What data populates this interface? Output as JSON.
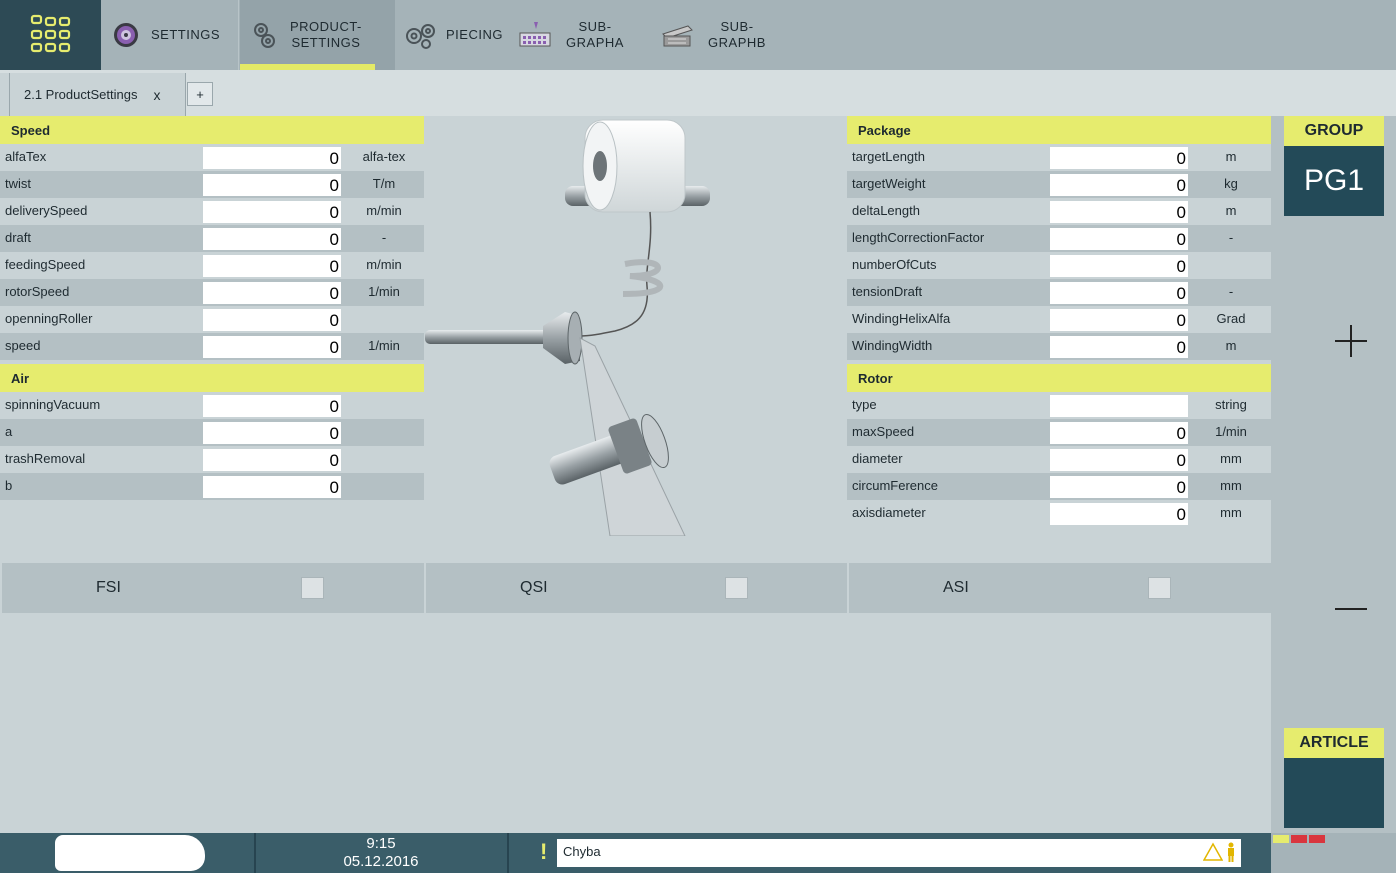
{
  "nav": {
    "settings": "SETTINGS",
    "product_line1": "PRODUCT-",
    "product_line2": "SETTINGS",
    "piecing": "PIECING",
    "suba_line1": "SUB-",
    "suba_line2": "GRAPHA",
    "subb_line1": "SUB-",
    "subb_line2": "GRAPHB",
    "icons": [
      "app-grid-icon",
      "settings-disc-icon",
      "gears-icon",
      "gears-icon",
      "keyboard-icon",
      "device-icon"
    ],
    "accent": "#e6ec6e"
  },
  "tabs": {
    "active_label": "2.1 ProductSettings",
    "close": "x",
    "add": "+"
  },
  "speed": {
    "title": "Speed",
    "rows": [
      {
        "label": "alfaTex",
        "value": "0",
        "unit": "alfa-tex"
      },
      {
        "label": "twist",
        "value": "0",
        "unit": "T/m"
      },
      {
        "label": "deliverySpeed",
        "value": "0",
        "unit": "m/min"
      },
      {
        "label": "draft",
        "value": "0",
        "unit": "-"
      },
      {
        "label": "feedingSpeed",
        "value": "0",
        "unit": "m/min"
      },
      {
        "label": "rotorSpeed",
        "value": "0",
        "unit": "1/min"
      },
      {
        "label": "openningRoller",
        "value": "0",
        "unit": ""
      },
      {
        "label": "speed",
        "value": "0",
        "unit": "1/min"
      }
    ]
  },
  "air": {
    "title": "Air",
    "rows": [
      {
        "label": "spinningVacuum",
        "value": "0",
        "unit": ""
      },
      {
        "label": "a",
        "value": "0",
        "unit": ""
      },
      {
        "label": "trashRemoval",
        "value": "0",
        "unit": ""
      },
      {
        "label": "b",
        "value": "0",
        "unit": ""
      }
    ]
  },
  "package": {
    "title": "Package",
    "rows": [
      {
        "label": "targetLength",
        "value": "0",
        "unit": "m"
      },
      {
        "label": "targetWeight",
        "value": "0",
        "unit": "kg"
      },
      {
        "label": "deltaLength",
        "value": "0",
        "unit": "m"
      },
      {
        "label": "lengthCorrectionFactor",
        "value": "0",
        "unit": "-"
      },
      {
        "label": "numberOfCuts",
        "value": "0",
        "unit": ""
      },
      {
        "label": "tensionDraft",
        "value": "0",
        "unit": "-"
      },
      {
        "label": "WindingHelixAlfa",
        "value": "0",
        "unit": "Grad"
      },
      {
        "label": "WindingWidth",
        "value": "0",
        "unit": "m"
      }
    ]
  },
  "rotor": {
    "title": "Rotor",
    "rows": [
      {
        "label": "type",
        "value": "",
        "unit": "string"
      },
      {
        "label": "maxSpeed",
        "value": "0",
        "unit": "1/min"
      },
      {
        "label": "diameter",
        "value": "0",
        "unit": "mm"
      },
      {
        "label": "circumFerence",
        "value": "0",
        "unit": "mm"
      },
      {
        "label": "axisdiameter",
        "value": "0",
        "unit": "mm"
      }
    ]
  },
  "options": [
    {
      "label": "FSI",
      "checked": false
    },
    {
      "label": "QSI",
      "checked": false
    },
    {
      "label": "ASI",
      "checked": false
    }
  ],
  "sidebar": {
    "group_title": "GROUP",
    "group_value": "PG1",
    "article_title": "ARTICLE"
  },
  "status": {
    "time": "9:15",
    "date": "05.12.2016",
    "warning_symbol": "!",
    "message": "Chyba"
  }
}
